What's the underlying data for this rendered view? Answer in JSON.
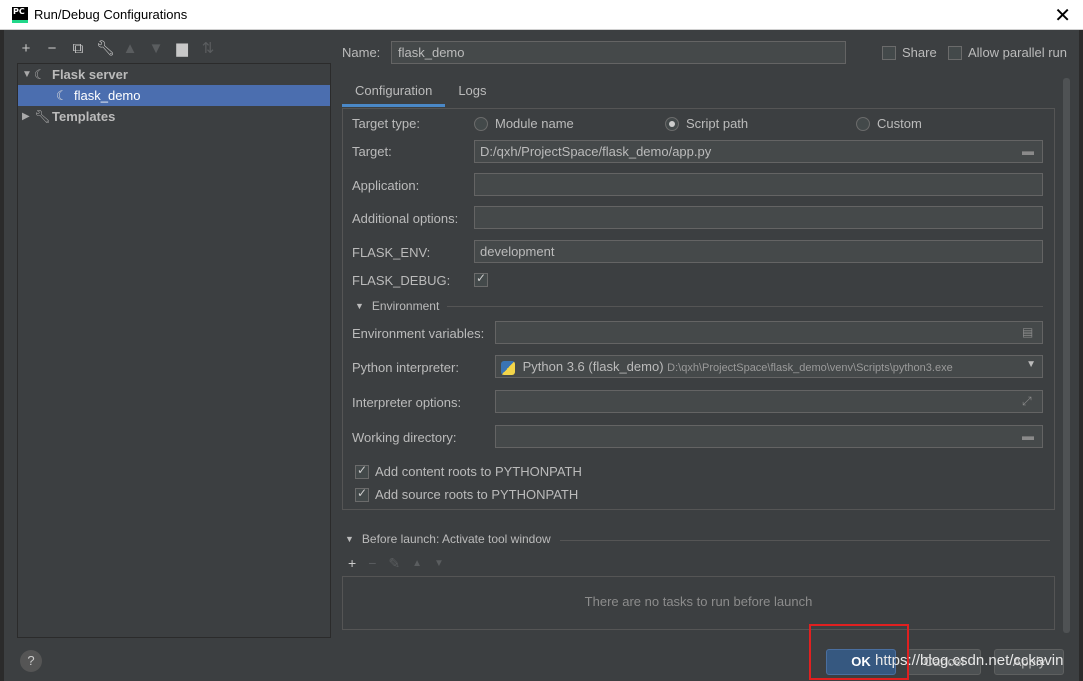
{
  "window": {
    "title": "Run/Debug Configurations",
    "icon_text": "PC"
  },
  "left_toolbar": {
    "icons": [
      "add-icon",
      "remove-icon",
      "copy-icon",
      "wrench-icon",
      "move-up-icon",
      "move-down-icon",
      "new-folder-icon",
      "sort-icon"
    ]
  },
  "tree": {
    "group": "Flask server",
    "selected_item": "flask_demo",
    "templates": "Templates"
  },
  "name": {
    "label": "Name:",
    "value": "flask_demo"
  },
  "share_label": "Share",
  "parallel_label": "Allow parallel run",
  "tabs": [
    "Configuration",
    "Logs"
  ],
  "config": {
    "target_type_label": "Target type:",
    "target_type_options": [
      "Module name",
      "Script path",
      "Custom"
    ],
    "target_type_selected": "Script path",
    "target_label": "Target:",
    "target_value": "D:/qxh/ProjectSpace/flask_demo/app.py",
    "application_label": "Application:",
    "application_value": "",
    "additional_label": "Additional options:",
    "additional_value": "",
    "flask_env_label": "FLASK_ENV:",
    "flask_env_value": "development",
    "flask_debug_label": "FLASK_DEBUG:",
    "flask_debug_checked": true,
    "environment_header": "Environment",
    "env_vars_label": "Environment variables:",
    "env_vars_value": "",
    "interpreter_label": "Python interpreter:",
    "interpreter_name": "Python 3.6 (flask_demo)",
    "interpreter_path": "D:\\qxh\\ProjectSpace\\flask_demo\\venv\\Scripts\\python3.exe",
    "interp_options_label": "Interpreter options:",
    "interp_options_value": "",
    "working_dir_label": "Working directory:",
    "working_dir_value": "",
    "content_roots_label": "Add content roots to PYTHONPATH",
    "source_roots_label": "Add source roots to PYTHONPATH"
  },
  "before_launch": {
    "header": "Before launch: Activate tool window",
    "empty_text": "There are no tasks to run before launch"
  },
  "buttons": {
    "help": "?",
    "ok": "OK",
    "cancel": "Cancel",
    "apply": "Apply"
  },
  "watermark": "https://blog.csdn.net/cckavin",
  "colors": {
    "background": "#3c3f41",
    "selection": "#4b6eaf",
    "tab_underline": "#4a88c7",
    "highlight_box": "#e02020"
  }
}
